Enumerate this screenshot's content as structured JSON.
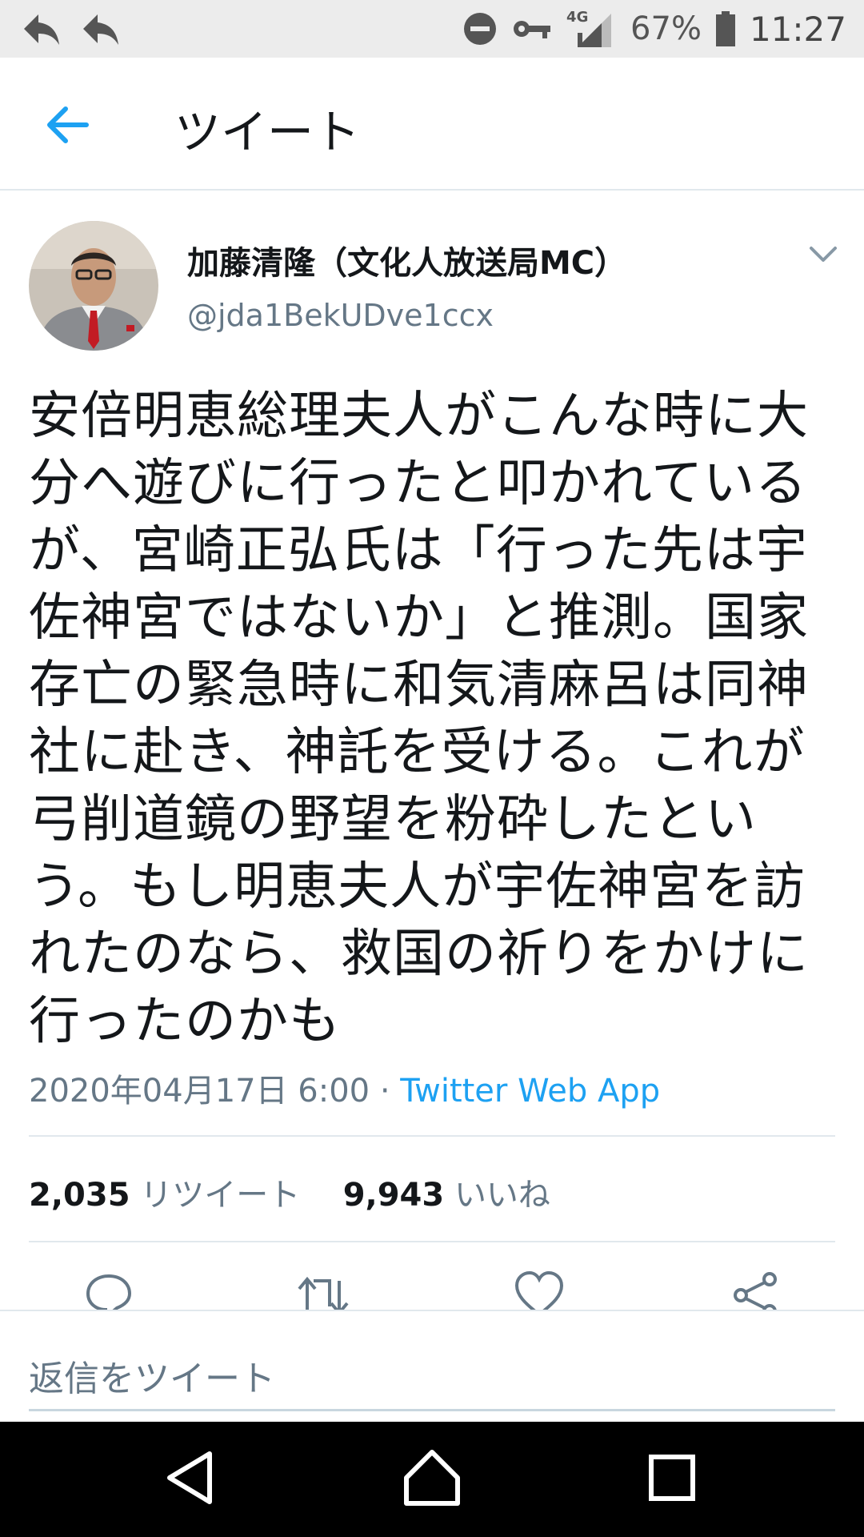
{
  "status_bar": {
    "battery_text": "67%",
    "network": "4G",
    "time": "11:27"
  },
  "header": {
    "title": "ツイート"
  },
  "tweet": {
    "author_name": "加藤清隆（文化人放送局MC）",
    "author_handle": "@jda1BekUDve1ccx",
    "text": "安倍明恵総理夫人がこんな時に大分へ遊びに行ったと叩かれているが、宮崎正弘氏は「行った先は宇佐神宮ではないか」と推測。国家存亡の緊急時に和気清麻呂は同神社に赴き、神託を受ける。これが弓削道鏡の野望を粉砕したという。もし明恵夫人が宇佐神宮を訪れたのなら、救国の祈りをかけに行ったのかも",
    "date": "2020年04月17日 6:00",
    "separator": " · ",
    "source": "Twitter Web App",
    "retweet_count": "2,035",
    "retweet_label": "リツイート",
    "like_count": "9,943",
    "like_label": "いいね"
  },
  "reply": {
    "placeholder": "返信をツイート"
  },
  "colors": {
    "accent": "#1da1f2",
    "muted": "#657786",
    "text": "#14171a"
  },
  "icons": {
    "back": "arrow-left-icon",
    "chevron": "chevron-down-icon",
    "reply": "reply-icon",
    "retweet": "retweet-icon",
    "like": "heart-icon",
    "share": "share-icon"
  }
}
